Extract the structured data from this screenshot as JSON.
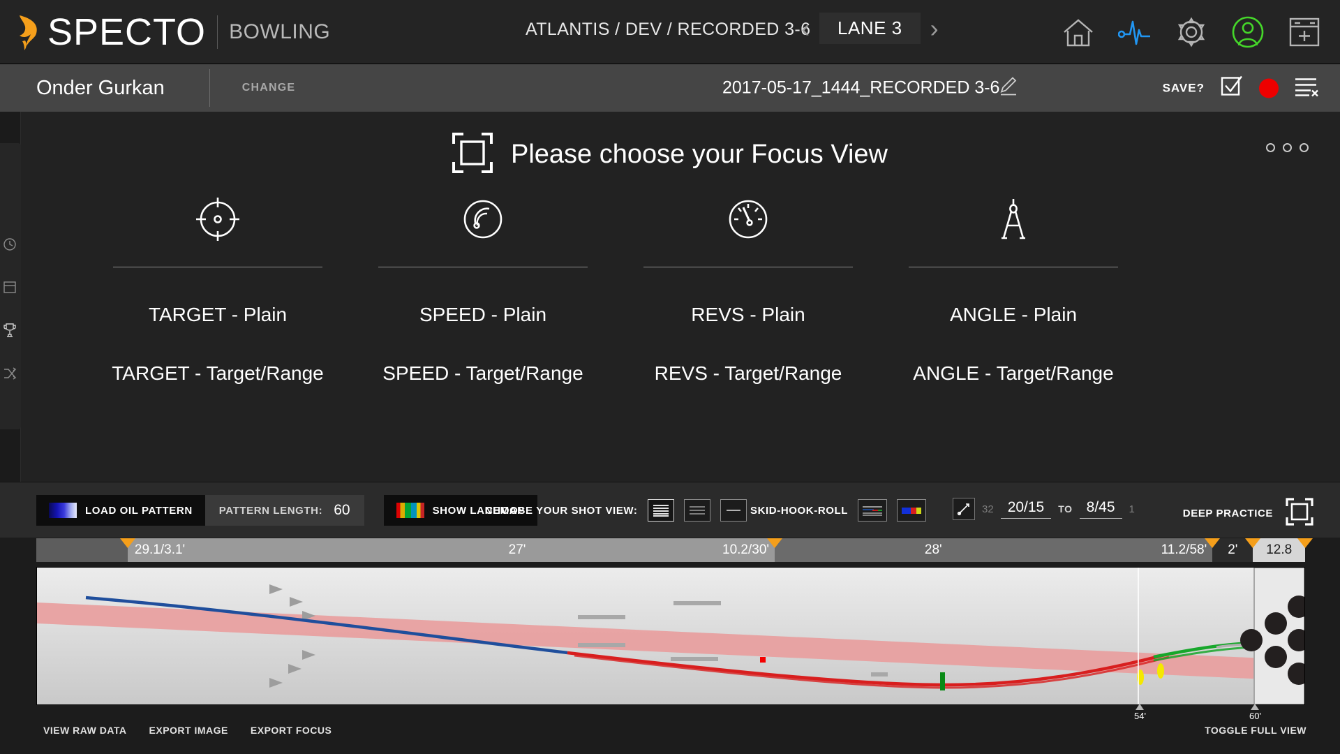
{
  "header": {
    "brand": "SPECTO",
    "brand_sub": "BOWLING",
    "breadcrumb": "ATLANTIS / DEV / RECORDED 3-6",
    "lane": "LANE 3",
    "prev_arrow": "‹",
    "next_arrow": "›",
    "icons": [
      "home-icon",
      "pulse-icon",
      "gear-icon",
      "user-avatar-icon",
      "add-window-icon"
    ],
    "accent_orange": "#f59f1b",
    "pulse_blue": "#2196f3",
    "avatar_green": "#45d62a"
  },
  "subheader": {
    "user_name": "Onder Gurkan",
    "change_label": "CHANGE",
    "session_title": "2017-05-17_1444_RECORDED 3-6",
    "edit_icon": "pencil-icon",
    "save_label": "SAVE?",
    "record_color": "#ee0000"
  },
  "focus": {
    "title": "Please choose your Focus View",
    "frame_icon": "focus-frame-icon",
    "columns": [
      {
        "icon": "crosshair-icon",
        "plain": "TARGET - Plain",
        "range": "TARGET - Target/Range"
      },
      {
        "icon": "speedometer-icon",
        "plain": "SPEED - Plain",
        "range": "SPEED - Target/Range"
      },
      {
        "icon": "revs-gauge-icon",
        "plain": "REVS - Plain",
        "range": "REVS - Target/Range"
      },
      {
        "icon": "compass-divider-icon",
        "plain": "ANGLE - Plain",
        "range": "ANGLE - Target/Range"
      }
    ]
  },
  "toolbar": {
    "load_oil_pattern": "LOAD OIL PATTERN",
    "pattern_length_label": "PATTERN LENGTH:",
    "pattern_length_value": "60",
    "show_lanemap": "SHOW LANEMAP",
    "shot_view_label": "CHOOSE YOUR SHOT VIEW:",
    "skid_hook_roll_label": "SKID-HOOK-ROLL",
    "range_left_dim": "32",
    "range_left_value": "20/15",
    "range_to": "TO",
    "range_right_value": "8/45",
    "range_right_dim": "1",
    "deep_practice": "DEEP PRACTICE"
  },
  "ruler": {
    "segments": [
      {
        "label": "29.1/3.1'",
        "width": 23.4,
        "align": "left",
        "shade": "#9a9a9a",
        "text": "#ffffff"
      },
      {
        "label": "27'",
        "width": 14.6,
        "align": "center",
        "shade": "#9a9a9a",
        "text": "#ffffff"
      },
      {
        "label": "10.2/30'",
        "width": 0.0,
        "align": "right",
        "shade": "#9a9a9a",
        "text": "#ffffff"
      },
      {
        "label": "28'",
        "width": 45.0,
        "align": "center",
        "shade": "#6b6b6b",
        "text": "#ffffff"
      },
      {
        "label": "11.2/58'",
        "width": 9.5,
        "align": "right",
        "shade": "#6b6b6b",
        "text": "#ffffff"
      },
      {
        "label": "2'",
        "width": 3.2,
        "align": "center",
        "shade": "#2b2b2b",
        "text": "#ffffff"
      },
      {
        "label": "12.8",
        "width": 4.3,
        "align": "center",
        "shade": "#d6d6d6",
        "text": "#1b1b1b"
      }
    ]
  },
  "lane": {
    "distance_54": "54'",
    "distance_60": "60'",
    "ball_line_blue": "#1f4e9c",
    "ball_line_red": "#d81e1e",
    "ball_line_green": "#17a72b",
    "oil_band": "#e8a0a0",
    "marker_yellow": "#f5e800",
    "marker_green": "#0a8a16",
    "marker_red": "#f50000"
  },
  "footer": {
    "view_raw_data": "VIEW RAW DATA",
    "export_image": "EXPORT IMAGE",
    "export_focus": "EXPORT FOCUS",
    "toggle_full_view": "TOGGLE FULL VIEW"
  }
}
